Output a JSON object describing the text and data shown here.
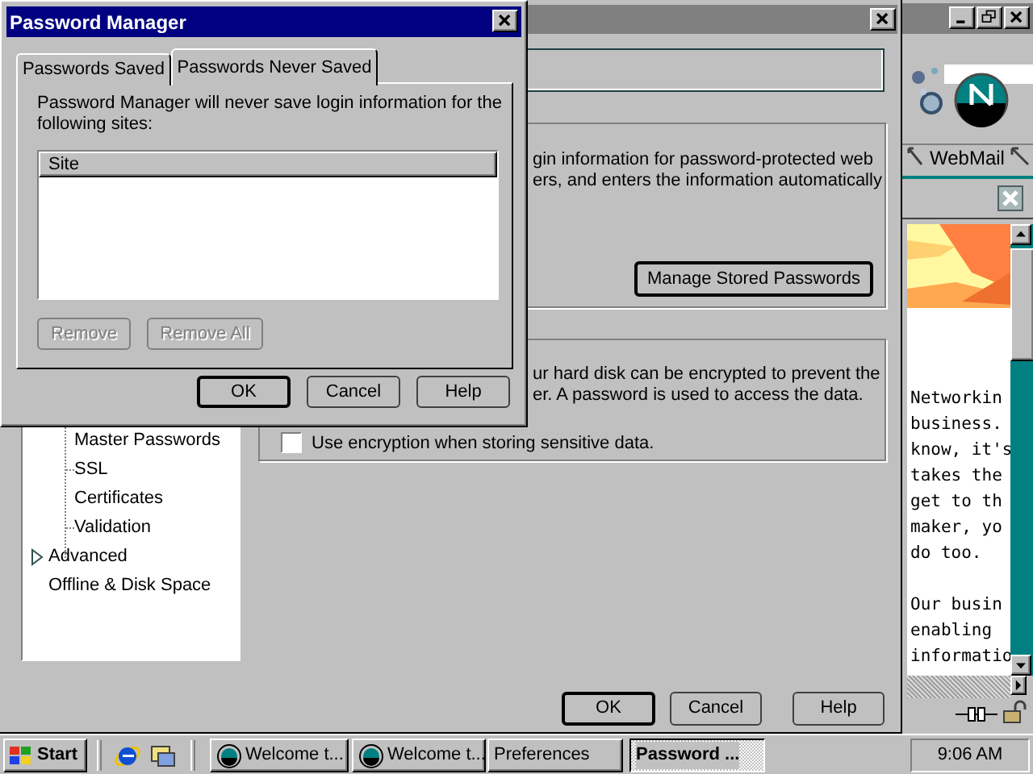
{
  "browser": {
    "toolbar_label": "WebMail",
    "article_paragraphs": [
      [
        "Networkin",
        "business.",
        "know, it's",
        "takes the",
        "get to th",
        "maker, yo",
        "do too."
      ],
      [
        "Our busin",
        "enabling",
        "informatio"
      ]
    ]
  },
  "preferences": {
    "tree": {
      "children": [
        {
          "label": "Master Passwords"
        },
        {
          "label": "SSL"
        },
        {
          "label": "Certificates"
        },
        {
          "label": "Validation"
        }
      ],
      "items": [
        {
          "label": "Advanced",
          "has_children": true
        },
        {
          "label": "Offline & Disk Space",
          "has_children": false
        }
      ]
    },
    "passwords_text": [
      "gin information for password-protected web",
      "ers, and enters the information automatically"
    ],
    "manage_button": "Manage Stored Passwords",
    "encryption_text": [
      "ur hard disk can be encrypted to prevent the",
      "er. A password is used to access the data."
    ],
    "encryption_checkbox": {
      "label": "Use encryption when storing sensitive data.",
      "checked": false
    },
    "buttons": [
      {
        "label": "OK",
        "default": true
      },
      {
        "label": "Cancel",
        "default": false
      },
      {
        "label": "Help",
        "default": false
      }
    ]
  },
  "password_manager": {
    "title": "Password Manager",
    "tabs": [
      {
        "label": "Passwords Saved",
        "selected": false
      },
      {
        "label": "Passwords Never Saved",
        "selected": true
      }
    ],
    "description": "Password Manager will never save login information for the following sites:",
    "list": {
      "columns": [
        "Site"
      ]
    },
    "list_buttons": [
      {
        "label": "Remove",
        "disabled": true
      },
      {
        "label": "Remove All",
        "disabled": true
      }
    ],
    "buttons": [
      {
        "label": "OK",
        "default": true
      },
      {
        "label": "Cancel",
        "default": false
      },
      {
        "label": "Help",
        "default": false
      }
    ]
  },
  "taskbar": {
    "start": "Start",
    "tasks": [
      {
        "label": "Welcome t...",
        "has_icon": true,
        "selected": false
      },
      {
        "label": "Welcome t...",
        "has_icon": true,
        "selected": false
      },
      {
        "label": "Preferences",
        "has_icon": false,
        "selected": false
      },
      {
        "label": "Password ...",
        "has_icon": false,
        "selected": true
      }
    ],
    "clock": "9:06 AM"
  }
}
